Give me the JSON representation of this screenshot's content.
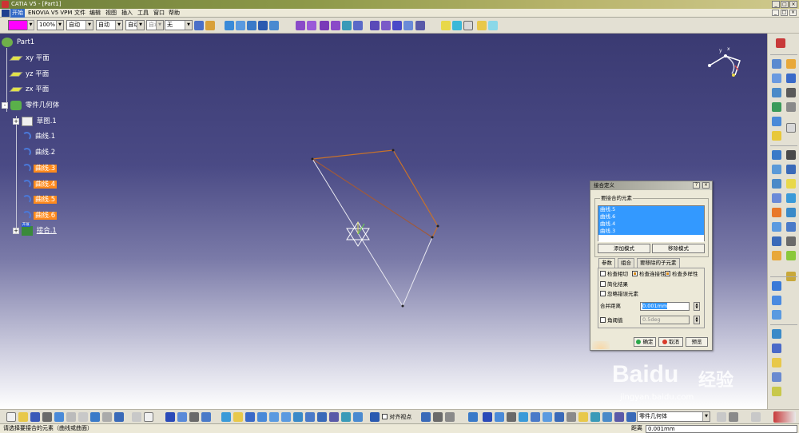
{
  "window": {
    "title": "CATIA V5 - [Part1]",
    "buttons": [
      "_",
      "□",
      "×"
    ]
  },
  "menu": {
    "items": [
      "开始",
      "ENOVIA V5 VPM",
      "文件",
      "编辑",
      "视图",
      "插入",
      "工具",
      "窗口",
      "帮助"
    ]
  },
  "graphic_props": {
    "color": "#ff00ff",
    "transparency": "100%",
    "line_thickness": "自动",
    "line_type": "自动",
    "point_symbol": "自动",
    "layer_label": "自动",
    "layer": "无"
  },
  "tree": {
    "root": "Part1",
    "planes": [
      "xy 平面",
      "yz 平面",
      "zx 平面"
    ],
    "body": "零件几何体",
    "sketch": "草图.1",
    "curves": [
      {
        "label": "曲线.1",
        "highlighted": false
      },
      {
        "label": "曲线.2",
        "highlighted": false
      },
      {
        "label": "曲线.3",
        "highlighted": true
      },
      {
        "label": "曲线.4",
        "highlighted": true
      },
      {
        "label": "曲线.5",
        "highlighted": true
      },
      {
        "label": "曲线.6",
        "highlighted": true
      }
    ],
    "join": "接合.1",
    "join_badge": "开展"
  },
  "compass": {
    "x": "x",
    "y": "y"
  },
  "dialog": {
    "title": "接合定义",
    "title_buttons": [
      "?",
      "×"
    ],
    "group_label": "要接合的元素",
    "list_items": [
      "曲线.5",
      "曲线.6",
      "曲线.4",
      "曲线.3"
    ],
    "add_mode": "添加模式",
    "remove_mode": "移除模式",
    "tabs": [
      "参数",
      "组合",
      "要移除的子元素"
    ],
    "check_tangency": "检查相切",
    "check_connexity": "检查连接性",
    "check_manifold": "检查多样性",
    "simplify": "简化结果",
    "ignore_errors": "忽略错误元素",
    "merge_distance_label": "合并距离",
    "merge_distance_value": "0.001mm",
    "angular_threshold_label": "角阈值",
    "angular_threshold_value": "0.5deg",
    "ok": "确定",
    "cancel": "取消",
    "preview": "预览"
  },
  "bottom": {
    "align_views": "对齐视点",
    "body_select": "零件几何体"
  },
  "status": {
    "message": "请选择要接合的元素（曲线或曲面）",
    "distance_label": "距离",
    "distance_value": "0.001mm"
  },
  "watermark": {
    "brand": "Baidu",
    "brand_cn": "经验",
    "url": "jingyan.baidu.com"
  },
  "colors": {
    "background_top": "#3a3a72",
    "highlight_orange": "#ff8a1c",
    "selection_blue": "#3399ff",
    "curve_orange": "#c8722a",
    "curve_white": "#e8e8f0"
  }
}
